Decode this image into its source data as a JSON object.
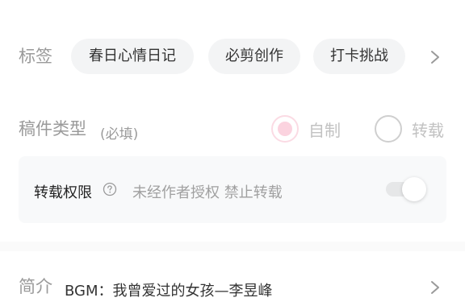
{
  "tags": {
    "label": "标签",
    "chips": [
      "春日心情日记",
      "必剪创作",
      "打卡挑战"
    ],
    "more_icon": "chevron-right-icon"
  },
  "manuscript_type": {
    "label": "稿件类型",
    "required_note": "(必填)",
    "options": [
      {
        "label": "自制",
        "selected": true
      },
      {
        "label": "转载",
        "selected": false
      }
    ]
  },
  "repost_permission": {
    "title": "转载权限",
    "help_icon": "question-circle-icon",
    "description": "未经作者授权 禁止转载",
    "enabled": false
  },
  "intro": {
    "label": "简介",
    "text": "BGM：我曾爱过的女孩—李昱峰",
    "more_icon": "chevron-right-icon"
  },
  "colors": {
    "label_gray": "#9a9a9a",
    "chip_bg": "#f3f4f5",
    "radio_selected_pink": "#fbd3df",
    "card_bg": "#f8f9fa"
  }
}
